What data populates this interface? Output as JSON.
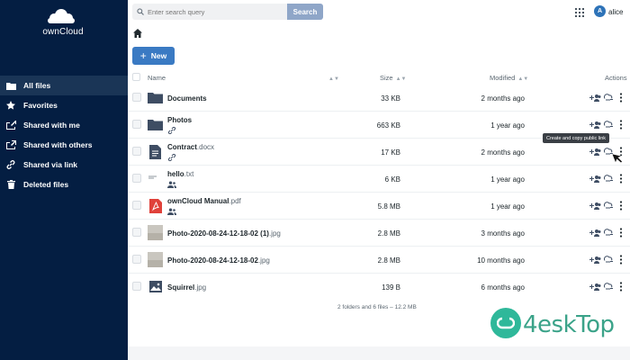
{
  "brand": {
    "logo_text": "ownCloud"
  },
  "sidebar": {
    "items": [
      {
        "label": "All files",
        "icon": "folder-icon",
        "active": true
      },
      {
        "label": "Favorites",
        "icon": "star-icon"
      },
      {
        "label": "Shared with me",
        "icon": "share-in-icon"
      },
      {
        "label": "Shared with others",
        "icon": "share-out-icon"
      },
      {
        "label": "Shared via link",
        "icon": "link-icon"
      },
      {
        "label": "Deleted files",
        "icon": "trash-icon"
      }
    ]
  },
  "header": {
    "search_placeholder": "Enter search query",
    "search_button": "Search",
    "avatar_initial": "A",
    "username": "alice"
  },
  "toolbar": {
    "new_label": "New",
    "new_symbol": "+"
  },
  "table": {
    "columns": {
      "name": "Name",
      "size": "Size",
      "modified": "Modified",
      "actions": "Actions"
    },
    "rows": [
      {
        "name": "Documents",
        "ext": "",
        "type": "folder",
        "size": "33 KB",
        "modified": "2 months ago",
        "shared": ""
      },
      {
        "name": "Photos",
        "ext": "",
        "type": "folder",
        "size": "663 KB",
        "modified": "1 year ago",
        "shared": "link"
      },
      {
        "name": "Contract",
        "ext": ".docx",
        "type": "doc",
        "size": "17 KB",
        "modified": "2 months ago",
        "shared": "link"
      },
      {
        "name": "hello",
        "ext": ".txt",
        "type": "txt",
        "size": "6 KB",
        "modified": "1 year ago",
        "shared": "users"
      },
      {
        "name": "ownCloud Manual",
        "ext": ".pdf",
        "type": "pdf",
        "size": "5.8 MB",
        "modified": "1 year ago",
        "shared": "users"
      },
      {
        "name": "Photo-2020-08-24-12-18-02 (1)",
        "ext": ".jpg",
        "type": "photo",
        "size": "2.8 MB",
        "modified": "3 months ago",
        "shared": ""
      },
      {
        "name": "Photo-2020-08-24-12-18-02",
        "ext": ".jpg",
        "type": "photo",
        "size": "2.8 MB",
        "modified": "10 months ago",
        "shared": ""
      },
      {
        "name": "Squirrel",
        "ext": ".jpg",
        "type": "image",
        "size": "139 B",
        "modified": "6 months ago",
        "shared": ""
      }
    ],
    "summary": "2 folders and 6 files – 12.2 MB"
  },
  "tooltip": "Create and copy public link",
  "watermark": {
    "text": "4eskTop"
  },
  "colors": {
    "sidebar_bg": "#041e42",
    "accent": "#3a7ac3",
    "search_button": "#8fa6c8"
  }
}
